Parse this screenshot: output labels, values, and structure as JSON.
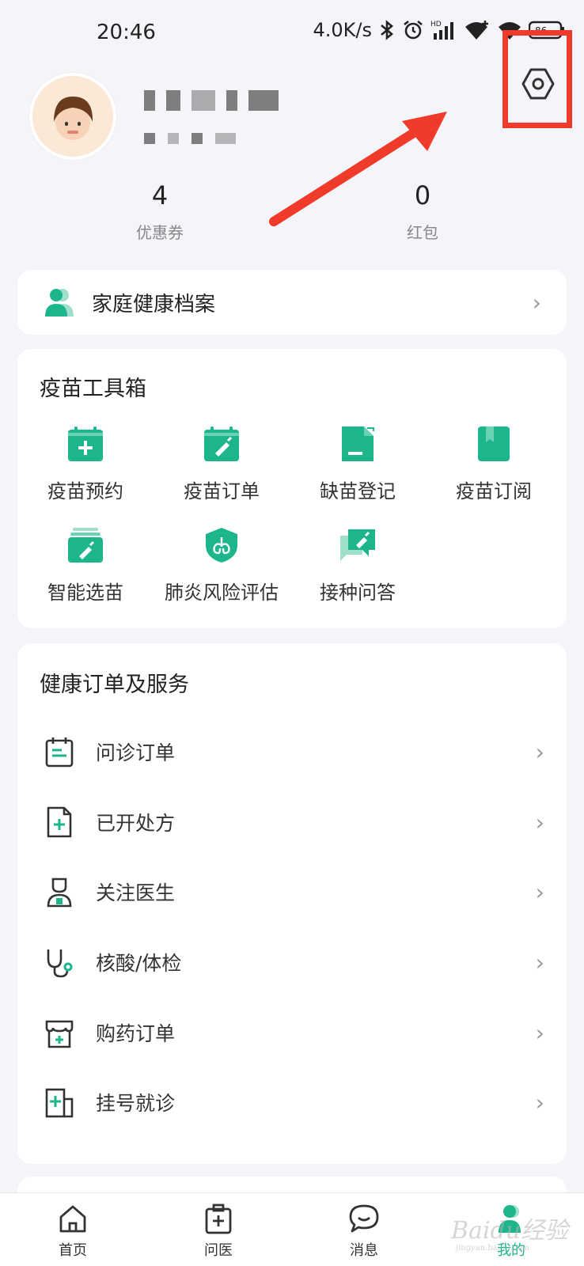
{
  "status_bar": {
    "time": "20:46",
    "network_speed": "4.0K/s",
    "icons": [
      "bluetooth-icon",
      "alarm-icon",
      "hd-signal-icon",
      "wifi-plus-icon",
      "wifi-icon",
      "battery-icon"
    ]
  },
  "profile": {
    "coupons": {
      "count": "4",
      "label": "优惠券"
    },
    "red_packets": {
      "count": "0",
      "label": "红包"
    },
    "settings_icon": "hexagon-gear-icon"
  },
  "family_record": {
    "label": "家庭健康档案"
  },
  "vaccine_toolbox": {
    "title": "疫苗工具箱",
    "tools": [
      {
        "label": "疫苗预约",
        "icon": "calendar-plus-icon"
      },
      {
        "label": "疫苗订单",
        "icon": "calendar-syringe-icon"
      },
      {
        "label": "缺苗登记",
        "icon": "document-edit-icon"
      },
      {
        "label": "疫苗订阅",
        "icon": "bookmark-book-icon"
      },
      {
        "label": "智能选苗",
        "icon": "stacked-syringe-icon"
      },
      {
        "label": "肺炎风险评估",
        "icon": "shield-lungs-icon"
      },
      {
        "label": "接种问答",
        "icon": "chat-syringe-icon"
      }
    ]
  },
  "health_services": {
    "title": "健康订单及服务",
    "items": [
      {
        "label": "问诊订单",
        "icon": "clipboard-list-icon"
      },
      {
        "label": "已开处方",
        "icon": "prescription-file-icon"
      },
      {
        "label": "关注医生",
        "icon": "doctor-icon"
      },
      {
        "label": "核酸/体检",
        "icon": "stethoscope-icon"
      },
      {
        "label": "购药订单",
        "icon": "pharmacy-store-icon"
      },
      {
        "label": "挂号就诊",
        "icon": "hospital-register-icon"
      }
    ]
  },
  "bottom_nav": {
    "items": [
      {
        "label": "首页",
        "icon": "home-icon"
      },
      {
        "label": "问医",
        "icon": "medical-kit-icon"
      },
      {
        "label": "消息",
        "icon": "chat-bubble-icon"
      },
      {
        "label": "我的",
        "icon": "user-icon",
        "active": true
      }
    ]
  },
  "colors": {
    "accent": "#1cb58c",
    "highlight": "#f03a2a",
    "background": "#f4f5f8"
  }
}
